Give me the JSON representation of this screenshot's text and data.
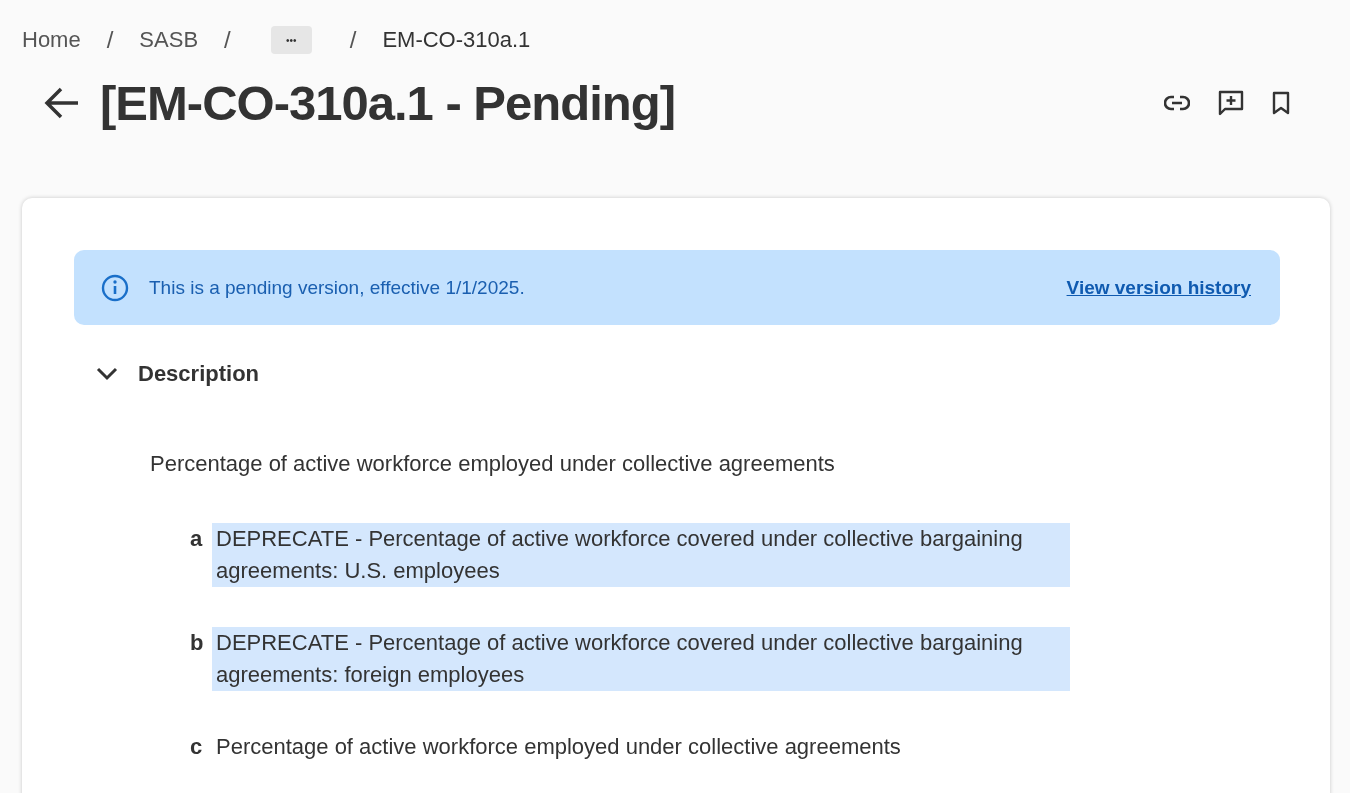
{
  "breadcrumb": [
    {
      "label": "Home",
      "kind": "link"
    },
    {
      "label": "SASB",
      "kind": "link"
    },
    {
      "label": "•••",
      "kind": "ellipsis"
    },
    {
      "label": "EM-CO-310a.1",
      "kind": "current"
    }
  ],
  "breadcrumb_separator": "/",
  "title": "[EM-CO-310a.1 - Pending]",
  "banner": {
    "message": "This is a pending version, effective 1/1/2025.",
    "link": "View version history"
  },
  "section": {
    "title": "Description",
    "expanded": true,
    "summary": "Percentage of active workforce employed under collective agreements",
    "items": [
      {
        "letter": "a",
        "text": "DEPRECATE - Percentage of active workforce covered under collective bargaining agreements: U.S. employees",
        "highlighted": true
      },
      {
        "letter": "b",
        "text": "DEPRECATE - Percentage of active workforce covered under collective bargaining agreements: foreign employees",
        "highlighted": true
      },
      {
        "letter": "c",
        "text": "Percentage of active workforce employed under collective agreements",
        "highlighted": false
      }
    ]
  }
}
